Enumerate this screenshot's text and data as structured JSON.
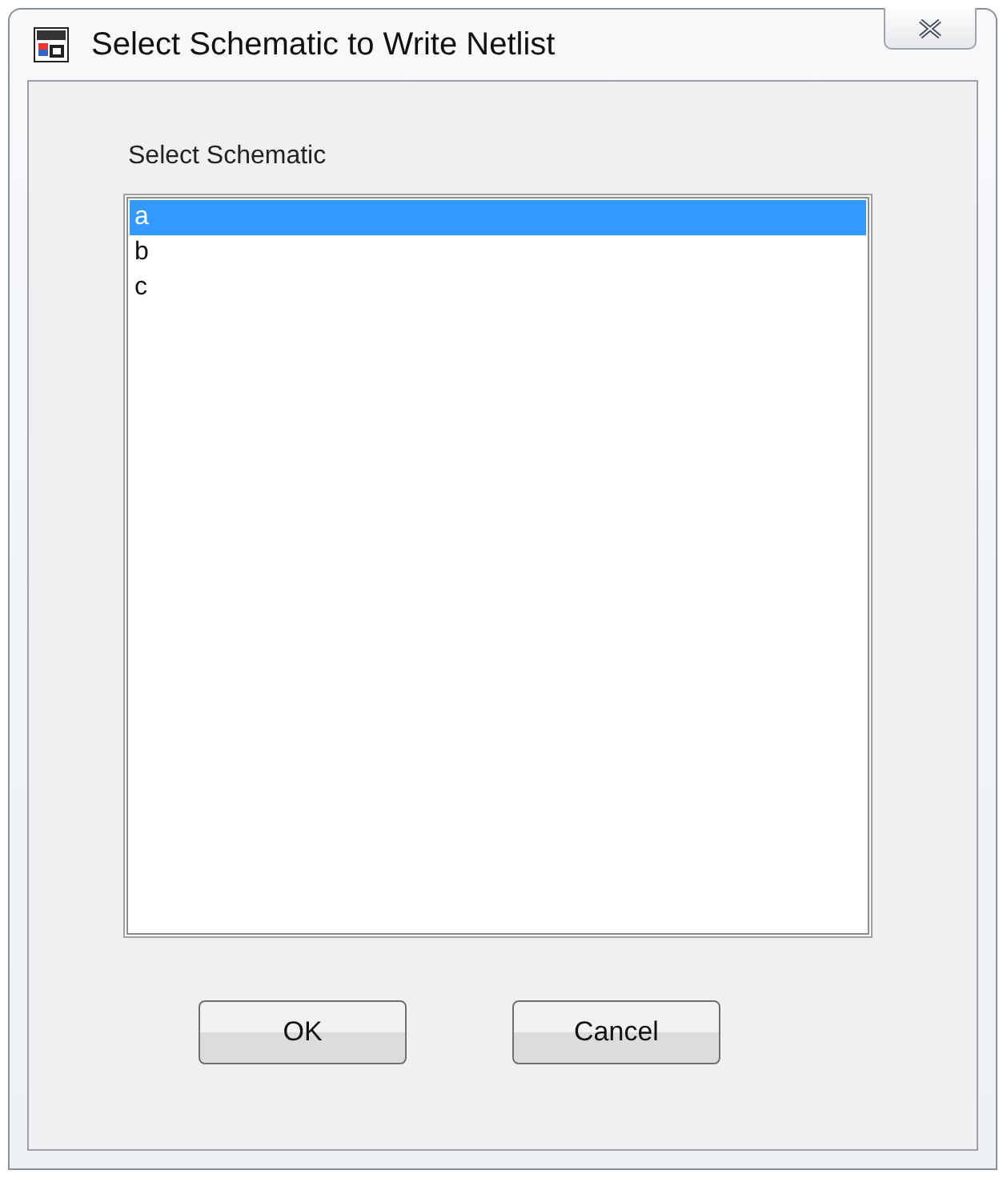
{
  "window": {
    "title": "Select Schematic to Write Netlist"
  },
  "list": {
    "label": "Select Schematic",
    "items": [
      {
        "text": "a",
        "selected": true
      },
      {
        "text": "b",
        "selected": false
      },
      {
        "text": "c",
        "selected": false
      }
    ]
  },
  "buttons": [
    "OK",
    "Cancel"
  ]
}
